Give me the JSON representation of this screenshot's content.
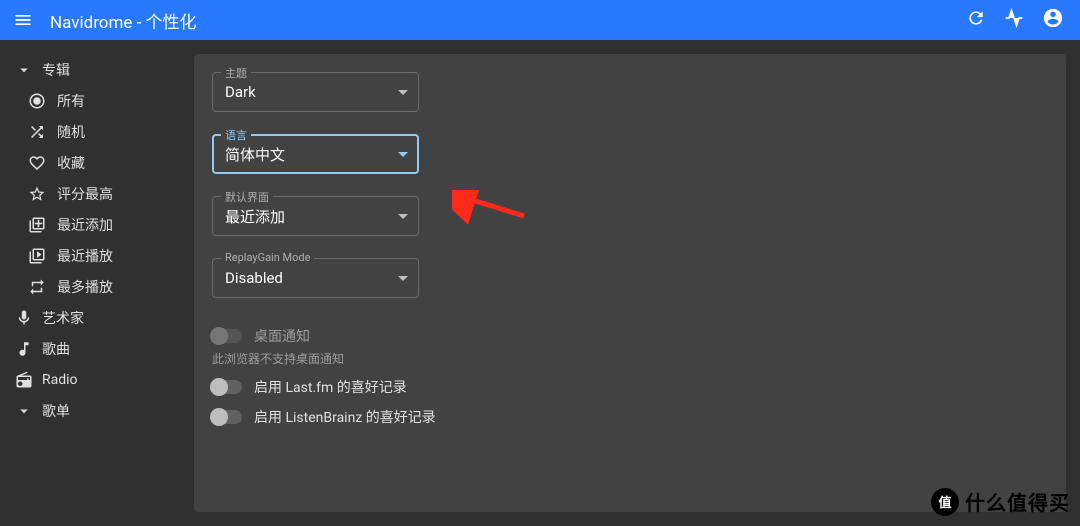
{
  "appbar": {
    "title": "Navidrome - 个性化"
  },
  "sidebar": {
    "albums": {
      "label": "专辑",
      "items": [
        {
          "label": "所有"
        },
        {
          "label": "随机"
        },
        {
          "label": "收藏"
        },
        {
          "label": "评分最高"
        },
        {
          "label": "最近添加"
        },
        {
          "label": "最近播放"
        },
        {
          "label": "最多播放"
        }
      ]
    },
    "artists": {
      "label": "艺术家"
    },
    "songs": {
      "label": "歌曲"
    },
    "radio": {
      "label": "Radio"
    },
    "playlists": {
      "label": "歌单"
    }
  },
  "settings": {
    "theme": {
      "label": "主题",
      "value": "Dark"
    },
    "language": {
      "label": "语言",
      "value": "简体中文"
    },
    "defaultView": {
      "label": "默认界面",
      "value": "最近添加"
    },
    "replayGain": {
      "label": "ReplayGain Mode",
      "value": "Disabled"
    },
    "desktopNotifications": {
      "label": "桌面通知"
    },
    "notificationsCaption": "此浏览器不支持桌面通知",
    "lastfm": {
      "label": "启用 Last.fm 的喜好记录"
    },
    "listenbrainz": {
      "label": "启用 ListenBrainz 的喜好记录"
    }
  },
  "watermark": {
    "badge": "值",
    "text": "什么值得买"
  }
}
